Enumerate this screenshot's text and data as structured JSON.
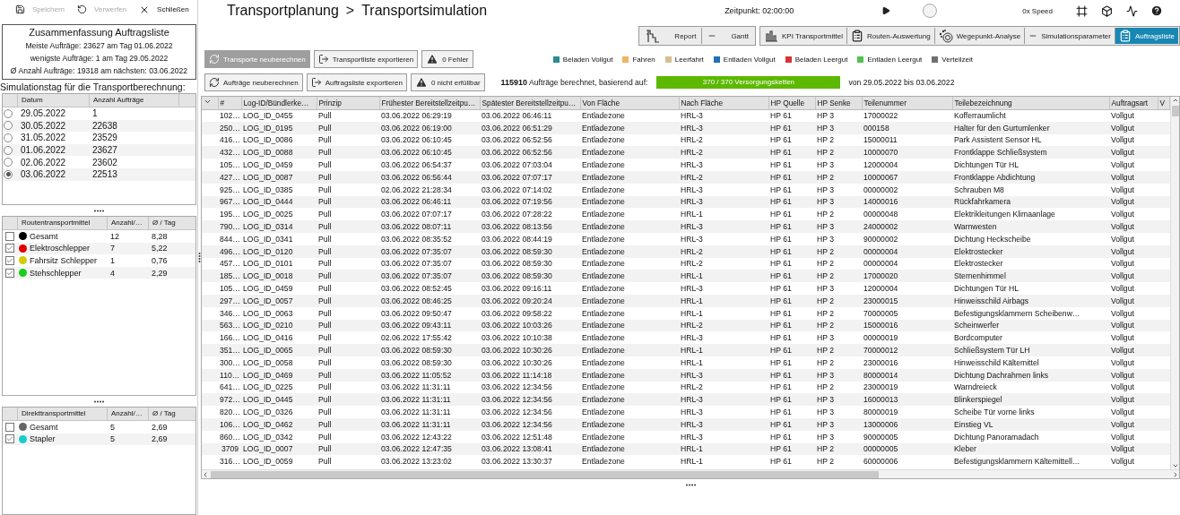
{
  "toolbar": [
    {
      "label": "Speichern",
      "kind": "save",
      "disabled": true
    },
    {
      "label": "Verwerfen",
      "kind": "undo",
      "disabled": true
    },
    {
      "label": "Schließen",
      "kind": "close",
      "disabled": false
    }
  ],
  "summary": {
    "title": "Zusammenfassung Auftragsliste",
    "lines": [
      "Meiste Aufträge: 23627 am Tag 01.06.2022",
      "wenigste Aufträge: 1 am Tag 29.05.2022",
      "Ø Anzahl Aufträge: 19318 am nächsten: 03.06.2022"
    ]
  },
  "simulation_day": {
    "label": "Simulationstag für die Transportberechnung:",
    "columns": [
      "Datum",
      "Anzahl Aufträge"
    ],
    "rows": [
      {
        "date": "29.05.2022",
        "count": "1",
        "selected": false
      },
      {
        "date": "30.05.2022",
        "count": "22638",
        "selected": false
      },
      {
        "date": "31.05.2022",
        "count": "23529",
        "selected": false
      },
      {
        "date": "01.06.2022",
        "count": "23627",
        "selected": false
      },
      {
        "date": "02.06.2022",
        "count": "23602",
        "selected": false
      },
      {
        "date": "03.06.2022",
        "count": "22513",
        "selected": true
      }
    ]
  },
  "route_transport": {
    "columns": [
      "Routentransportmittel",
      "Anzahl/…",
      "Ø / Tag"
    ],
    "rows": [
      {
        "name": "Gesamt",
        "color": "#000000",
        "checked": false,
        "count": "12",
        "per_day": "8,28"
      },
      {
        "name": "Elektroschlepper",
        "color": "#e00000",
        "checked": true,
        "count": "7",
        "per_day": "5,22"
      },
      {
        "name": "Fahrsitz Schlepper",
        "color": "#d4cc00",
        "checked": true,
        "count": "1",
        "per_day": "0,76"
      },
      {
        "name": "Stehschlepper",
        "color": "#1ccc1c",
        "checked": true,
        "count": "4",
        "per_day": "2,29"
      }
    ]
  },
  "direct_transport": {
    "columns": [
      "Direkttransportmittel",
      "Anzahl/…",
      "Ø / Tag"
    ],
    "rows": [
      {
        "name": "Gesamt",
        "color": "#666666",
        "checked": false,
        "count": "5",
        "per_day": "2,69"
      },
      {
        "name": "Stapler",
        "color": "#1ccccc",
        "checked": true,
        "count": "5",
        "per_day": "2,69"
      }
    ]
  },
  "breadcrumb": {
    "parent": "Transportplanung",
    "separator": ">",
    "current": "Transportsimulation"
  },
  "playback": {
    "time": "Zeitpunkt: 02:00:00",
    "level": 0.25,
    "speed": "0x Speed"
  },
  "view_tab_groups": [
    {
      "tabs": [
        {
          "label": "Report",
          "kind": "stairs",
          "selected": false
        },
        {
          "label": "Gantt",
          "kind": "dash",
          "selected": false
        }
      ]
    },
    {
      "tabs": [
        {
          "label": "KPI Transportmittel",
          "kind": "bars",
          "selected": false
        },
        {
          "label": "Routen-Auswertung",
          "kind": "clipboard",
          "selected": false
        },
        {
          "label": "Wegepunkt-Analyse",
          "kind": "waypoint",
          "selected": false
        },
        {
          "label": "Simulationsparameter",
          "kind": "dash",
          "selected": false
        },
        {
          "label": "Auftragsliste",
          "kind": "clipboard",
          "selected": true
        }
      ]
    }
  ],
  "action_rows": [
    [
      {
        "label": "Transporte neuberechnen",
        "kind": "refresh",
        "disabled": true
      },
      {
        "label": "Transportliste exportieren",
        "kind": "export",
        "disabled": false
      },
      {
        "label": "0 Fehler",
        "kind": "warning",
        "disabled": false
      }
    ],
    [
      {
        "label": "Aufträge neuberechnen",
        "kind": "refresh",
        "disabled": false
      },
      {
        "label": "Auftragsliste exportieren",
        "kind": "export",
        "disabled": false
      },
      {
        "label": "0 nicht erfüllbar",
        "kind": "warning",
        "disabled": false
      }
    ]
  ],
  "legend": [
    {
      "label": "Beladen Vollgut",
      "color": "#2a8c8c"
    },
    {
      "label": "Fahren",
      "color": "#f2b264"
    },
    {
      "label": "Leerfahrt",
      "color": "#d6be8e"
    },
    {
      "label": "Entladen Vollgut",
      "color": "#1f70b8"
    },
    {
      "label": "Beladen Leergut",
      "color": "#d43434"
    },
    {
      "label": "Entladen Leergut",
      "color": "#52c052"
    },
    {
      "label": "Verteilzeit",
      "color": "#707070"
    }
  ],
  "result": {
    "count": "115910",
    "text": "Aufträge berechnet, basierend auf:",
    "progress": {
      "label": "370 / 370 Versorgungsketten",
      "level": 1
    },
    "range": "von 29.05.2022 bis 03.06.2022"
  },
  "table": {
    "columns": [
      "#",
      "Log-ID/Bündlerke…",
      "Prinzip",
      "Frühester Bereitstellzeitpu…",
      "Spätester Bereitstellzeitpu…",
      "Von Fläche",
      "Nach Fläche",
      "HP Quelle",
      "HP Senke",
      "Teilenummer",
      "Teilebezeichnung",
      "Auftragsart",
      "V"
    ],
    "rows": [
      [
        "102…",
        "LOG_ID_0455",
        "Pull",
        "03.06.2022 06:29:19",
        "03.06.2022 06:46:11",
        "Entladezone",
        "HRL-3",
        "HP 61",
        "HP 3",
        "17000022",
        "Kofferraumlicht",
        "Vollgut"
      ],
      [
        "250…",
        "LOG_ID_0195",
        "Pull",
        "03.06.2022 06:19:00",
        "03.06.2022 06:51:29",
        "Entladezone",
        "HRL-3",
        "HP 61",
        "HP 3",
        "000158",
        "Halter für den Gurtumlenker",
        "Vollgut"
      ],
      [
        "416…",
        "LOG_ID_0086",
        "Pull",
        "03.06.2022 06:10:45",
        "03.06.2022 06:52:56",
        "Entladezone",
        "HRL-2",
        "HP 61",
        "HP 2",
        "15000011",
        "Park Assistent Sensor HL",
        "Vollgut"
      ],
      [
        "432…",
        "LOG_ID_0088",
        "Pull",
        "03.06.2022 06:10:45",
        "03.06.2022 06:52:56",
        "Entladezone",
        "HRL-2",
        "HP 61",
        "HP 2",
        "10000070",
        "Frontklappe Schließsystem",
        "Vollgut"
      ],
      [
        "105…",
        "LOG_ID_0459",
        "Pull",
        "03.06.2022 06:54:37",
        "03.06.2022 07:03:04",
        "Entladezone",
        "HRL-3",
        "HP 61",
        "HP 3",
        "12000004",
        "Dichtungen Tür HL",
        "Vollgut"
      ],
      [
        "427…",
        "LOG_ID_0087",
        "Pull",
        "03.06.2022 06:56:44",
        "03.06.2022 07:07:17",
        "Entladezone",
        "HRL-2",
        "HP 61",
        "HP 2",
        "10000067",
        "Frontklappe Abdichtung",
        "Vollgut"
      ],
      [
        "925…",
        "LOG_ID_0385",
        "Pull",
        "02.06.2022 21:28:34",
        "03.06.2022 07:14:02",
        "Entladezone",
        "HRL-3",
        "HP 61",
        "HP 3",
        "00000002",
        "Schrauben M8",
        "Vollgut"
      ],
      [
        "967…",
        "LOG_ID_0444",
        "Pull",
        "03.06.2022 06:46:11",
        "03.06.2022 07:19:56",
        "Entladezone",
        "HRL-3",
        "HP 61",
        "HP 3",
        "14000016",
        "Rückfahrkamera",
        "Vollgut"
      ],
      [
        "195…",
        "LOG_ID_0025",
        "Pull",
        "03.06.2022 07:07:17",
        "03.06.2022 07:28:22",
        "Entladezone",
        "HRL-1",
        "HP 61",
        "HP 2",
        "00000048",
        "Elektrikleitungen Klimaanlage",
        "Vollgut"
      ],
      [
        "790…",
        "LOG_ID_0314",
        "Pull",
        "03.06.2022 08:07:11",
        "03.06.2022 08:13:56",
        "Entladezone",
        "HRL-3",
        "HP 61",
        "HP 3",
        "24000002",
        "Warnwesten",
        "Vollgut"
      ],
      [
        "844…",
        "LOG_ID_0341",
        "Pull",
        "03.06.2022 08:35:52",
        "03.06.2022 08:44:19",
        "Entladezone",
        "HRL-3",
        "HP 61",
        "HP 3",
        "90000002",
        "Dichtung Heckscheibe",
        "Vollgut"
      ],
      [
        "496…",
        "LOG_ID_0120",
        "Pull",
        "03.06.2022 07:35:07",
        "03.06.2022 08:59:30",
        "Entladezone",
        "HRL-2",
        "HP 61",
        "HP 2",
        "00000004",
        "Elektrostecker",
        "Vollgut"
      ],
      [
        "457…",
        "LOG_ID_0101",
        "Pull",
        "03.06.2022 07:35:07",
        "03.06.2022 08:59:30",
        "Entladezone",
        "HRL-2",
        "HP 61",
        "HP 2",
        "00000004",
        "Elektrostecker",
        "Vollgut"
      ],
      [
        "185…",
        "LOG_ID_0018",
        "Pull",
        "03.06.2022 07:35:07",
        "03.06.2022 08:59:30",
        "Entladezone",
        "HRL-1",
        "HP 61",
        "HP 2",
        "17000020",
        "Sternenhimmel",
        "Vollgut"
      ],
      [
        "105…",
        "LOG_ID_0459",
        "Pull",
        "03.06.2022 08:52:45",
        "03.06.2022 09:16:11",
        "Entladezone",
        "HRL-3",
        "HP 61",
        "HP 3",
        "12000004",
        "Dichtungen Tür HL",
        "Vollgut"
      ],
      [
        "297…",
        "LOG_ID_0057",
        "Pull",
        "03.06.2022 08:46:25",
        "03.06.2022 09:20:24",
        "Entladezone",
        "HRL-1",
        "HP 61",
        "HP 2",
        "23000015",
        "Hinweisschild Airbags",
        "Vollgut"
      ],
      [
        "346…",
        "LOG_ID_0063",
        "Pull",
        "03.06.2022 09:50:47",
        "03.06.2022 09:58:22",
        "Entladezone",
        "HRL-1",
        "HP 61",
        "HP 2",
        "70000005",
        "Befestigungsklammern Scheibenw…",
        "Vollgut"
      ],
      [
        "563…",
        "LOG_ID_0210",
        "Pull",
        "03.06.2022 09:43:11",
        "03.06.2022 10:03:26",
        "Entladezone",
        "HRL-2",
        "HP 61",
        "HP 2",
        "15000016",
        "Scheinwerfer",
        "Vollgut"
      ],
      [
        "166…",
        "LOG_ID_0416",
        "Pull",
        "02.06.2022 17:55:42",
        "03.06.2022 10:10:38",
        "Entladezone",
        "HRL-3",
        "HP 61",
        "HP 3",
        "00000019",
        "Bordcomputer",
        "Vollgut"
      ],
      [
        "351…",
        "LOG_ID_0065",
        "Pull",
        "03.06.2022 08:59:30",
        "03.06.2022 10:30:26",
        "Entladezone",
        "HRL-1",
        "HP 61",
        "HP 2",
        "70000012",
        "Schließsystem Tür LH",
        "Vollgut"
      ],
      [
        "300…",
        "LOG_ID_0058",
        "Pull",
        "03.06.2022 08:59:30",
        "03.06.2022 10:30:26",
        "Entladezone",
        "HRL-1",
        "HP 61",
        "HP 2",
        "23000016",
        "Hinweisschild Kältemittel",
        "Vollgut"
      ],
      [
        "110…",
        "LOG_ID_0469",
        "Pull",
        "03.06.2022 11:05:52",
        "03.06.2022 11:14:18",
        "Entladezone",
        "HRL-3",
        "HP 61",
        "HP 3",
        "80000014",
        "Dichtung Dachrahmen links",
        "Vollgut"
      ],
      [
        "641…",
        "LOG_ID_0225",
        "Pull",
        "03.06.2022 11:31:11",
        "03.06.2022 12:34:56",
        "Entladezone",
        "HRL-2",
        "HP 61",
        "HP 2",
        "23000019",
        "Warndreieck",
        "Vollgut"
      ],
      [
        "972…",
        "LOG_ID_0445",
        "Pull",
        "03.06.2022 11:31:11",
        "03.06.2022 12:34:56",
        "Entladezone",
        "HRL-3",
        "HP 61",
        "HP 3",
        "16000013",
        "Blinkerspiegel",
        "Vollgut"
      ],
      [
        "820…",
        "LOG_ID_0326",
        "Pull",
        "03.06.2022 11:31:11",
        "03.06.2022 12:34:56",
        "Entladezone",
        "HRL-3",
        "HP 61",
        "HP 3",
        "80000019",
        "Scheibe Tür vorne links",
        "Vollgut"
      ],
      [
        "106…",
        "LOG_ID_0462",
        "Pull",
        "03.06.2022 11:31:11",
        "03.06.2022 12:34:56",
        "Entladezone",
        "HRL-3",
        "HP 61",
        "HP 3",
        "13000006",
        "Einstieg VL",
        "Vollgut"
      ],
      [
        "860…",
        "LOG_ID_0342",
        "Pull",
        "03.06.2022 12:43:22",
        "03.06.2022 12:51:48",
        "Entladezone",
        "HRL-3",
        "HP 61",
        "HP 3",
        "90000005",
        "Dichtung Panoramadach",
        "Vollgut"
      ],
      [
        "3709",
        "LOG_ID_0007",
        "Pull",
        "03.06.2022 12:47:35",
        "03.06.2022 13:08:41",
        "Entladezone",
        "HRL-1",
        "HP 61",
        "HP 2",
        "00000005",
        "Kleber",
        "Vollgut"
      ],
      [
        "316…",
        "LOG_ID_0059",
        "Pull",
        "03.06.2022 13:23:02",
        "03.06.2022 13:30:37",
        "Entladezone",
        "HRL-1",
        "HP 61",
        "HP 2",
        "60000006",
        "Befestigungsklammern Kältemittell…",
        "Vollgut"
      ]
    ]
  }
}
